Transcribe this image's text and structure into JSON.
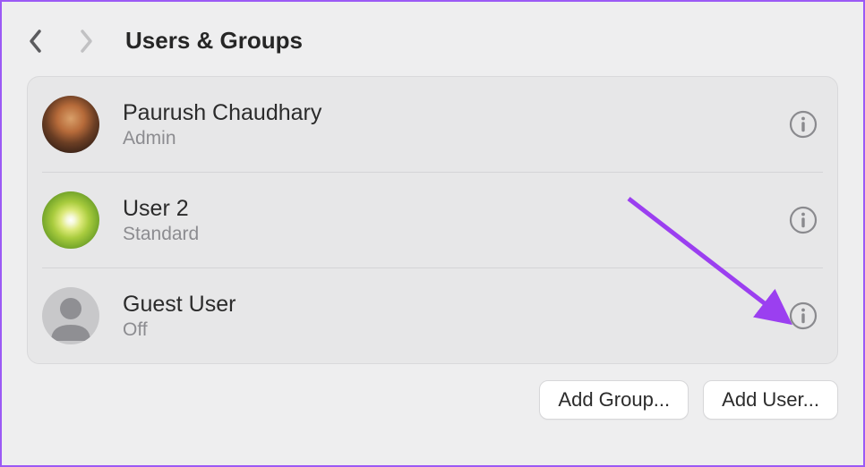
{
  "header": {
    "title": "Users & Groups"
  },
  "users": [
    {
      "name": "Paurush Chaudhary",
      "role": "Admin"
    },
    {
      "name": "User 2",
      "role": "Standard"
    },
    {
      "name": "Guest User",
      "role": "Off"
    }
  ],
  "footer": {
    "add_group_label": "Add Group...",
    "add_user_label": "Add User..."
  },
  "colors": {
    "accent_arrow": "#9b3ff0",
    "info_icon": "#8a8a8e"
  }
}
